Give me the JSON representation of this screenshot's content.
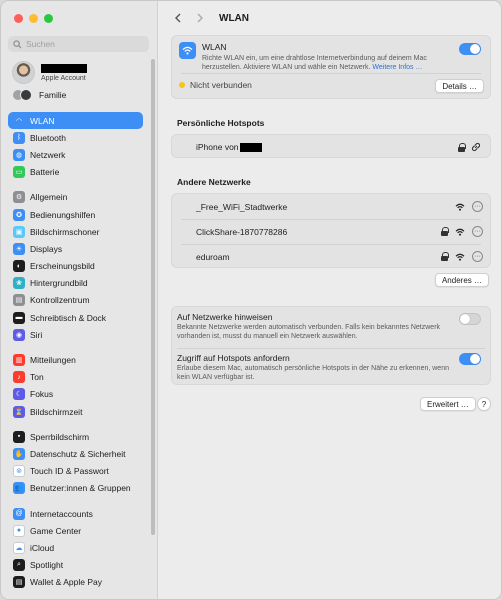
{
  "sidebar": {
    "search_placeholder": "Suchen",
    "account_subtitle": "Apple Account",
    "family_label": "Familie",
    "groups": [
      [
        {
          "label": "WLAN",
          "icon": "wifi-icon",
          "color": "#3d8ff6",
          "glyph": "◠",
          "active": true
        },
        {
          "label": "Bluetooth",
          "icon": "bluetooth-icon",
          "color": "#3d8ff6",
          "glyph": "ᛒ"
        },
        {
          "label": "Netzwerk",
          "icon": "network-icon",
          "color": "#3d8ff6",
          "glyph": "◍"
        },
        {
          "label": "Batterie",
          "icon": "battery-icon",
          "color": "#34c759",
          "glyph": "▭"
        }
      ],
      [
        {
          "label": "Allgemein",
          "icon": "gear-icon",
          "color": "#8e8e93",
          "glyph": "⚙"
        },
        {
          "label": "Bedienungshilfen",
          "icon": "accessibility-icon",
          "color": "#3d8ff6",
          "glyph": "✪"
        },
        {
          "label": "Bildschirmschoner",
          "icon": "screensaver-icon",
          "color": "#5ac8fa",
          "glyph": "▣"
        },
        {
          "label": "Displays",
          "icon": "display-icon",
          "color": "#3d8ff6",
          "glyph": "☀"
        },
        {
          "label": "Erscheinungsbild",
          "icon": "appearance-icon",
          "color": "#1d1d1f",
          "glyph": "◐"
        },
        {
          "label": "Hintergrundbild",
          "icon": "wallpaper-icon",
          "color": "#30b0c7",
          "glyph": "❀"
        },
        {
          "label": "Kontrollzentrum",
          "icon": "control-center-icon",
          "color": "#8e8e93",
          "glyph": "▤"
        },
        {
          "label": "Schreibtisch & Dock",
          "icon": "dock-icon",
          "color": "#1d1d1f",
          "glyph": "▬"
        },
        {
          "label": "Siri",
          "icon": "siri-icon",
          "color": "#5e5ce6",
          "glyph": "◉"
        }
      ],
      [
        {
          "label": "Mitteilungen",
          "icon": "notifications-icon",
          "color": "#ff3b30",
          "glyph": "▥"
        },
        {
          "label": "Ton",
          "icon": "sound-icon",
          "color": "#ff3b30",
          "glyph": "♪"
        },
        {
          "label": "Fokus",
          "icon": "focus-icon",
          "color": "#5e5ce6",
          "glyph": "☾"
        },
        {
          "label": "Bildschirmzeit",
          "icon": "screen-time-icon",
          "color": "#5e5ce6",
          "glyph": "⌛"
        }
      ],
      [
        {
          "label": "Sperrbildschirm",
          "icon": "lock-screen-icon",
          "color": "#1d1d1f",
          "glyph": "▪"
        },
        {
          "label": "Datenschutz & Sicherheit",
          "icon": "privacy-icon",
          "color": "#3d8ff6",
          "glyph": "✋"
        },
        {
          "label": "Touch ID & Passwort",
          "icon": "fingerprint-icon",
          "color": "#ffffff",
          "glyph": "⊚",
          "dark_glyph": true
        },
        {
          "label": "Benutzer:innen & Gruppen",
          "icon": "users-icon",
          "color": "#3d8ff6",
          "glyph": "👥"
        }
      ],
      [
        {
          "label": "Internetaccounts",
          "icon": "internet-accounts-icon",
          "color": "#3d8ff6",
          "glyph": "@"
        },
        {
          "label": "Game Center",
          "icon": "game-center-icon",
          "color": "#ffffff",
          "glyph": "●",
          "dark_glyph": true
        },
        {
          "label": "iCloud",
          "icon": "icloud-icon",
          "color": "#ffffff",
          "glyph": "☁",
          "dark_glyph": true
        },
        {
          "label": "Spotlight",
          "icon": "spotlight-icon",
          "color": "#1d1d1f",
          "glyph": "⌕"
        },
        {
          "label": "Wallet & Apple Pay",
          "icon": "wallet-icon",
          "color": "#1d1d1f",
          "glyph": "▤"
        }
      ]
    ]
  },
  "header": {
    "title": "WLAN"
  },
  "wlan_card": {
    "title": "WLAN",
    "description": "Richte WLAN ein, um eine drahtlose Internetverbindung auf deinem Mac herzustellen. Aktiviere WLAN und wähle ein Netzwerk.",
    "more_link": "Weitere Infos …",
    "toggle_on": true,
    "status_text": "Nicht verbunden",
    "status_color": "#f5c518",
    "details_button": "Details …"
  },
  "hotspots": {
    "title": "Persönliche Hotspots",
    "device_label": "iPhone von"
  },
  "other_networks": {
    "title": "Andere Netzwerke",
    "networks": [
      {
        "name": "_Free_WiFi_Stadtwerke",
        "locked": false
      },
      {
        "name": "ClickShare-1870778286",
        "locked": true
      },
      {
        "name": "eduroam",
        "locked": true
      }
    ],
    "other_button": "Anderes …"
  },
  "settings": {
    "notify_title": "Auf Netzwerke hinweisen",
    "notify_desc": "Bekannte Netzwerke werden automatisch verbunden. Falls kein bekanntes Netzwerk vorhanden ist, musst du manuell ein Netzwerk auswählen.",
    "notify_on": false,
    "hotspot_title": "Zugriff auf Hotspots anfordern",
    "hotspot_desc": "Erlaube diesem Mac, automatisch persönliche Hotspots in der Nähe zu erkennen, wenn kein WLAN verfügbar ist.",
    "hotspot_on": true
  },
  "footer": {
    "advanced_button": "Erweitert …",
    "help_button": "?"
  }
}
